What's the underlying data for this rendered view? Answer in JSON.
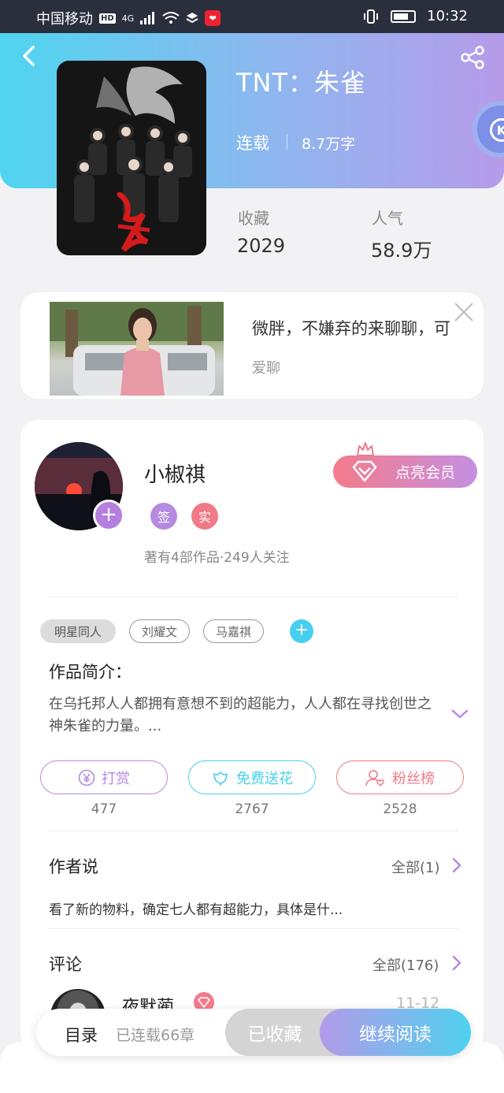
{
  "status_bar": {
    "carrier": "中国移动",
    "hd": "HD",
    "network": "4G",
    "time": "10:32"
  },
  "book": {
    "title": "TNT：朱雀",
    "status": "连载",
    "word_count": "8.7万字",
    "stats": [
      {
        "label": "收藏",
        "value": "2029"
      },
      {
        "label": "人气",
        "value": "58.9万"
      }
    ]
  },
  "ad": {
    "text": "微胖，不嫌弃的来聊聊，可",
    "source": "爱聊"
  },
  "author": {
    "name": "小椒祺",
    "badges": [
      "签",
      "实"
    ],
    "meta": "著有4部作品·249人关注",
    "vip_button": "点亮会员"
  },
  "tags": [
    "明星同人",
    "刘耀文",
    "马嘉祺"
  ],
  "intro": {
    "heading": "作品简介：",
    "text": "在乌托邦人人都拥有意想不到的超能力，人人都在寻找创世之神朱雀的力量。..."
  },
  "actions": [
    {
      "label": "打赏",
      "count": "477",
      "color": "#b58ae0"
    },
    {
      "label": "免费送花",
      "count": "2767",
      "color": "#45cff0"
    },
    {
      "label": "粉丝榜",
      "count": "2528",
      "color": "#f07a88"
    }
  ],
  "author_says": {
    "heading": "作者说",
    "more": "全部(1)",
    "text": "看了新的物料，确定七人都有超能力，具体是什..."
  },
  "comments": {
    "heading": "评论",
    "more": "全部(176)",
    "first": {
      "name": "夜默蔺",
      "date": "11-12"
    }
  },
  "bottom_bar": {
    "toc": "目录",
    "toc_sub": "已连载66章",
    "collected": "已收藏",
    "continue": "继续阅读"
  },
  "colors": {
    "hero_start": "#4fd5ef",
    "hero_end": "#b69be9",
    "accent_purple": "#b57fe0",
    "accent_cyan": "#45cff0",
    "accent_pink": "#f07a88"
  }
}
